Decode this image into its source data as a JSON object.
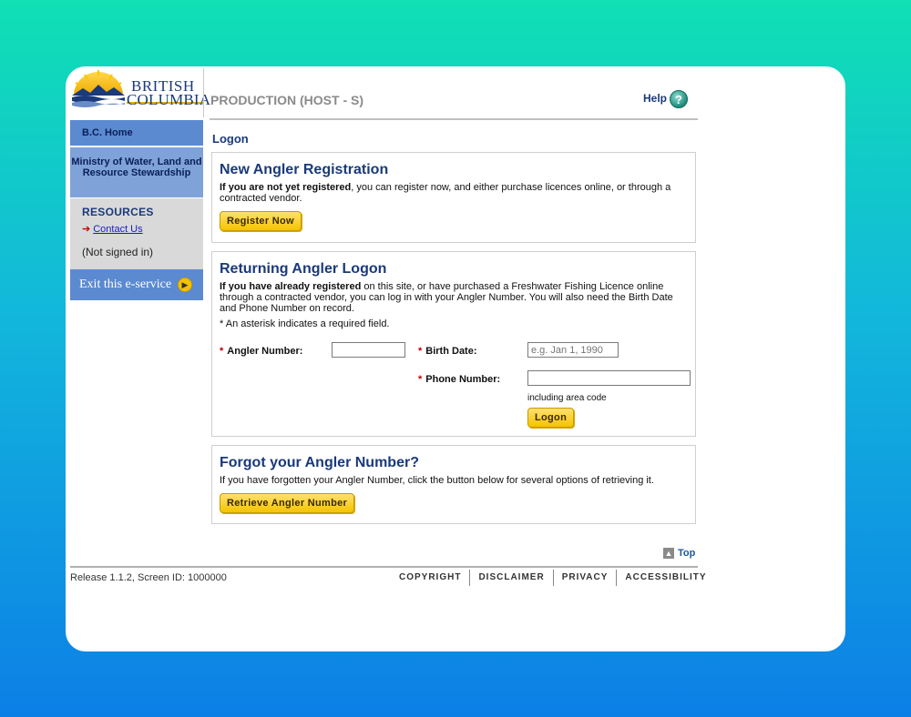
{
  "header": {
    "logo_line1": "BRITISH",
    "logo_line2": "COLUMBIA",
    "environment": "PRODUCTION (HOST - S)",
    "help_label": "Help",
    "help_icon": "?"
  },
  "sidebar": {
    "home": "B.C. Home",
    "ministry": "Ministry of Water, Land and Resource Stewardship",
    "resources_heading": "RESOURCES",
    "contact_arrow": "➔",
    "contact_label": "Contact Us",
    "status": "(Not signed in)",
    "exit_label": "Exit this e-service",
    "exit_icon": "▶"
  },
  "main": {
    "page_title": "Logon",
    "registration": {
      "title": "New Angler Registration",
      "text_bold": "If you are not yet registered",
      "text_rest": ", you can register now, and either purchase licences online, or through a contracted vendor.",
      "button": "Register Now"
    },
    "returning": {
      "title": "Returning Angler Logon",
      "text_bold": "If you have already registered",
      "text_rest": " on this site, or have purchased a Freshwater Fishing Licence online through a contracted vendor, you can log in with your Angler Number. You will also need the Birth Date and Phone Number on record.",
      "required_note": "* An asterisk indicates a required field.",
      "star": "*",
      "angler_label": "Angler Number:",
      "angler_value": "",
      "birth_label": "Birth Date:",
      "birth_placeholder": "e.g. Jan 1, 1990",
      "phone_label": "Phone Number:",
      "phone_value": "",
      "phone_hint": "including area code",
      "button": "Logon"
    },
    "forgot": {
      "title": "Forgot your Angler Number?",
      "text": "If you have forgotten your Angler Number, click the button below for several options of retrieving it.",
      "button": "Retrieve Angler Number"
    }
  },
  "footer": {
    "top_label": "Top",
    "top_icon": "▲",
    "release": "Release 1.1.2, Screen ID: 1000000",
    "links": [
      "COPYRIGHT",
      "DISCLAIMER",
      "PRIVACY",
      "ACCESSIBILITY"
    ]
  }
}
